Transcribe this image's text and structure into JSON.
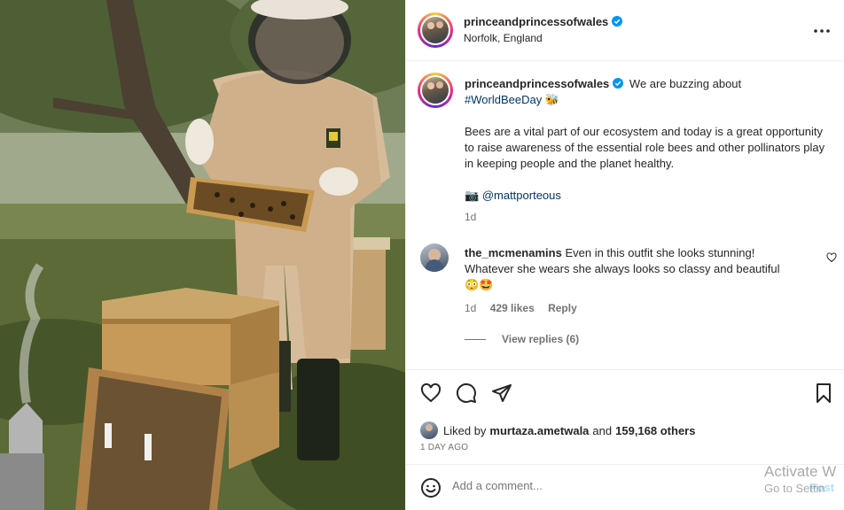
{
  "post": {
    "username": "princeandprincessofwales",
    "location": "Norfolk, England",
    "caption_intro": "We are buzzing about",
    "hashtag": "#WorldBeeDay",
    "bee_emoji": "🐝",
    "caption_body": "Bees are a vital part of our ecosystem and today is a great opportunity to raise awareness of the essential role bees and other pollinators play in keeping people and the planet healthy.",
    "camera_emoji": "📷",
    "credit_handle": "@mattporteous",
    "caption_time": "1d",
    "liked_by_prefix": "Liked by",
    "liked_by_user": "murtaza.ametwala",
    "liked_by_and": "and",
    "liked_by_others": "159,168 others",
    "post_date": "1 DAY AGO"
  },
  "comment": {
    "username": "the_mcmenamins",
    "text": "Even in this outfit she looks stunning! Whatever she wears she always looks so classy and beautiful",
    "emojis": "😳🤩",
    "time": "1d",
    "likes": "429 likes",
    "reply_label": "Reply",
    "view_replies": "View replies (6)"
  },
  "add_comment": {
    "placeholder": "Add a comment...",
    "post_label": "Post"
  },
  "icons": {
    "more": "more-horizontal-icon",
    "verified": "verified-badge-icon",
    "like": "heart-icon",
    "comment": "comment-bubble-icon",
    "share": "paper-plane-icon",
    "save": "bookmark-icon",
    "emoji": "smiley-icon",
    "comment_like": "small-heart-icon"
  },
  "colors": {
    "verified_blue": "#0095f6",
    "link_blue": "#00376b",
    "post_button": "#b2dffc",
    "text": "#262626",
    "muted": "#737373"
  },
  "watermark": {
    "line1": "Activate W",
    "line2": "Go to Settin"
  }
}
